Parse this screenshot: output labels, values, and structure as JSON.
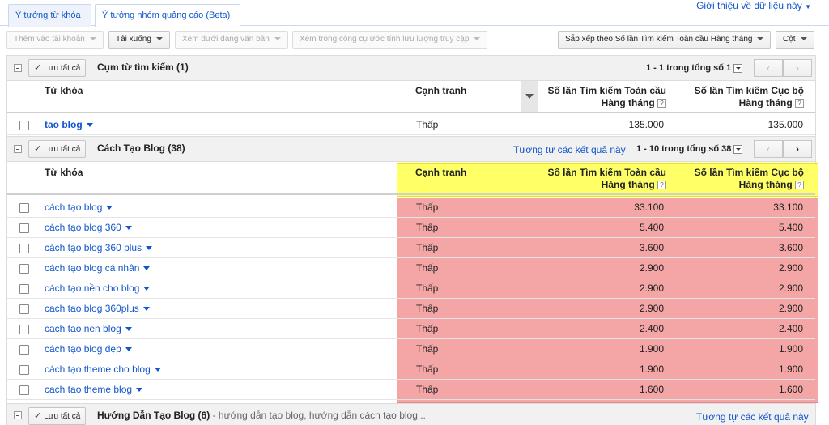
{
  "tabs": [
    {
      "label": "Ý tưởng từ khóa",
      "active": false
    },
    {
      "label": "Ý tưởng nhóm quảng cáo (Beta)",
      "active": true
    }
  ],
  "top_link": "Giới thiệu về dữ liệu này",
  "toolbar": {
    "add_to_account": "Thêm vào tài khoản",
    "download": "Tải xuống",
    "view_as_text": "Xem dưới dạng văn bản",
    "traffic_estimator": "Xem trong công cụ ước tính lưu lượng truy cập",
    "sort_by": "Sắp xếp theo Số lần Tìm kiếm Toàn cầu Hàng tháng",
    "columns": "Cột"
  },
  "columns": {
    "keyword": "Từ khóa",
    "competition": "Cạnh tranh",
    "global_searches": "Số lần Tìm kiếm Toàn cầu Hàng tháng",
    "local_searches": "Số lần Tìm kiếm Cục bộ Hàng tháng",
    "help": "?"
  },
  "save_all_label": "Lưu tất cả",
  "groups": [
    {
      "title": "Cụm từ tìm kiếm (1)",
      "pager": "1 - 1 trong tổng số 1",
      "rows": [
        {
          "keyword": "tao blog",
          "competition": "Thấp",
          "global": "135.000",
          "local": "135.000"
        }
      ]
    },
    {
      "title": "Cách Tạo Blog (38)",
      "similar": "Tương tự các kết quả này",
      "pager": "1 - 10 trong tổng số 38",
      "rows": [
        {
          "keyword": "cách tạo blog",
          "competition": "Thấp",
          "global": "33.100",
          "local": "33.100"
        },
        {
          "keyword": "cách tạo blog 360",
          "competition": "Thấp",
          "global": "5.400",
          "local": "5.400"
        },
        {
          "keyword": "cách tạo blog 360 plus",
          "competition": "Thấp",
          "global": "3.600",
          "local": "3.600"
        },
        {
          "keyword": "cách tạo blog cá nhân",
          "competition": "Thấp",
          "global": "2.900",
          "local": "2.900"
        },
        {
          "keyword": "cách tạo nền cho blog",
          "competition": "Thấp",
          "global": "2.900",
          "local": "2.900"
        },
        {
          "keyword": "cach tao blog 360plus",
          "competition": "Thấp",
          "global": "2.900",
          "local": "2.900"
        },
        {
          "keyword": "cach tao nen blog",
          "competition": "Thấp",
          "global": "2.400",
          "local": "2.400"
        },
        {
          "keyword": "cách tạo blog đẹp",
          "competition": "Thấp",
          "global": "1.900",
          "local": "1.900"
        },
        {
          "keyword": "cách tạo theme cho blog",
          "competition": "Thấp",
          "global": "1.900",
          "local": "1.900"
        },
        {
          "keyword": "cach tao theme blog",
          "competition": "Thấp",
          "global": "1.600",
          "local": "1.600"
        }
      ]
    },
    {
      "title": "Hướng Dẫn Tạo Blog (6)",
      "subtitle": "- hướng dẫn tạo blog, hướng dẫn cách tạo blog...",
      "similar": "Tương tự các kết quả này"
    }
  ],
  "colors": {
    "link": "#1155cc",
    "highlight_yellow": "#ffff66",
    "highlight_red": "#f4a5a5"
  }
}
